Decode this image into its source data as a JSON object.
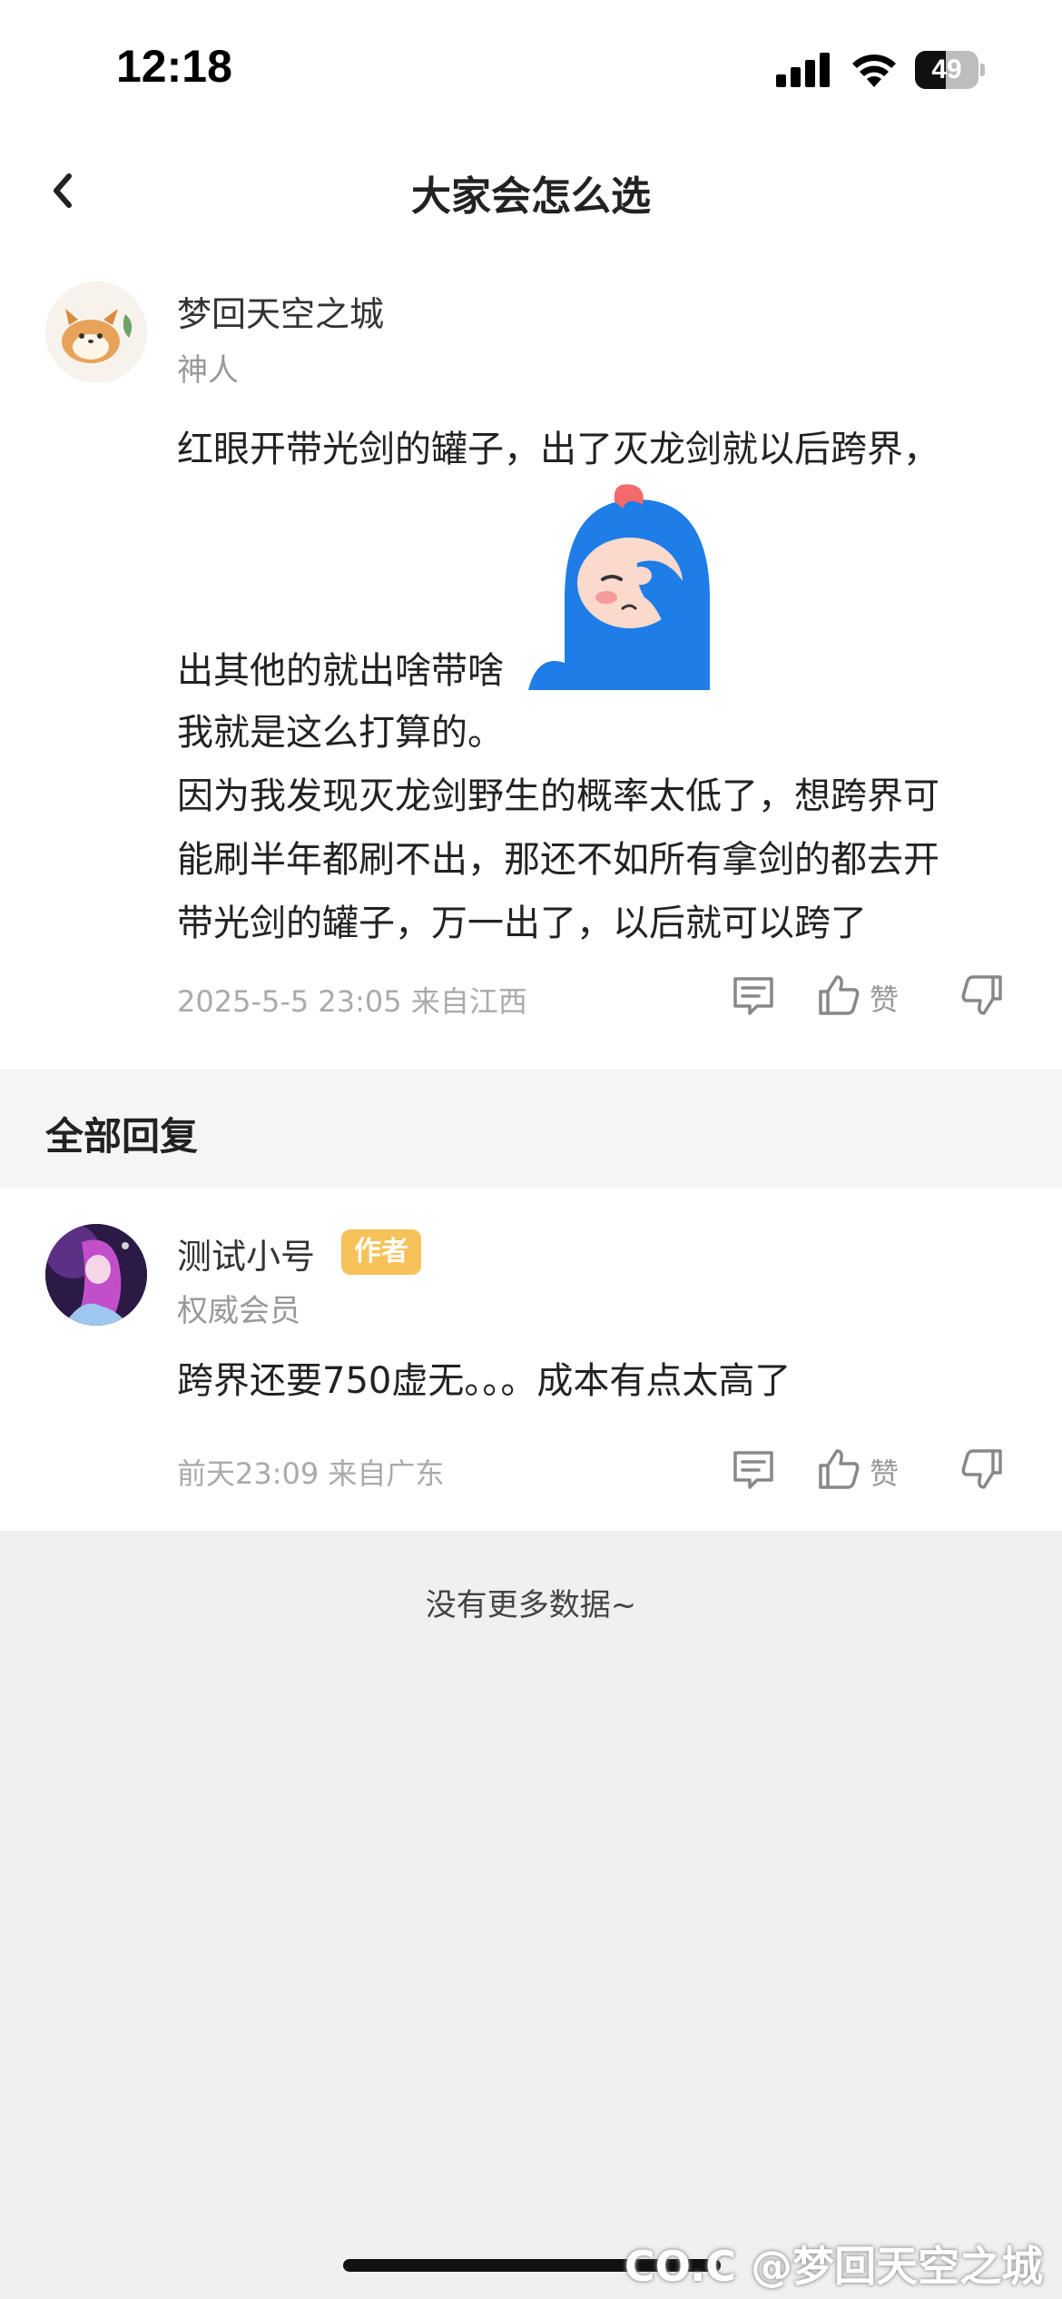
{
  "status_bar": {
    "time": "12:18",
    "battery": "49",
    "battery_level": 0.49
  },
  "nav": {
    "title": "大家会怎么选",
    "back_icon": "chevron-left-icon"
  },
  "post": {
    "username": "梦回天空之城",
    "level": "神人",
    "text_lines": [
      "红眼开带光剑的罐子，出了灭龙剑就以后跨界，",
      "出其他的就出啥带啥",
      "我就是这么打算的。",
      "因为我发现灭龙剑野生的概率太低了，想跨界可",
      "能刷半年都刷不出，那还不如所有拿剑的都去开",
      "带光剑的罐子，万一出了，以后就可以跨了"
    ],
    "sticker": "face-palm-sticker",
    "meta": "2025-5-5 23:05  来自江西",
    "like_label": "赞"
  },
  "section": {
    "title": "全部回复"
  },
  "reply": {
    "username": "测试小号",
    "badge": "作者",
    "level": "权威会员",
    "text": "跨界还要750虚无。。。成本有点太高了",
    "meta": "前天23:09 来自广东",
    "like_label": "赞"
  },
  "footer": {
    "no_more": "没有更多数据~"
  },
  "watermark": "CO.C @梦回天空之城",
  "colors": {
    "badge": "#f7c25a",
    "sticker_blue": "#1e7de6",
    "background": "#f0f0f0"
  }
}
